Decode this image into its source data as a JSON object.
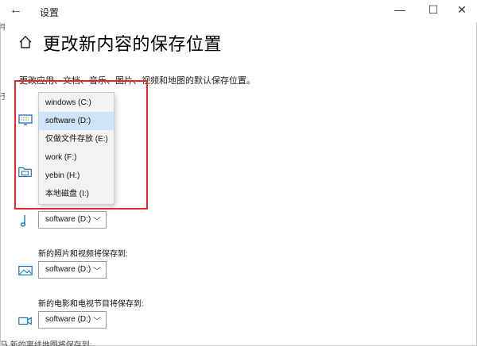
{
  "window": {
    "title": "设置",
    "back_glyph": "←",
    "minimize_glyph": "—",
    "maximize_glyph": "☐",
    "close_glyph": "✕"
  },
  "page": {
    "title": "更改新内容的保存位置",
    "description": "更改应用、文档、音乐、图片、视频和地图的默认保存位置。"
  },
  "dropdown_menu": {
    "options": [
      {
        "label": "windows (C:)",
        "selected": false
      },
      {
        "label": "software (D:)",
        "selected": true
      },
      {
        "label": "仅做文件存放 (E:)",
        "selected": false
      },
      {
        "label": "work (F:)",
        "selected": false
      },
      {
        "label": "yebin (H:)",
        "selected": false
      },
      {
        "label": "本地磁盘 (I:)",
        "selected": false
      }
    ]
  },
  "sections": {
    "music": {
      "value": "software (D:)"
    },
    "photos": {
      "label": "新的照片和视频将保存到:",
      "value": "software (D:)"
    },
    "movies": {
      "label": "新的电影和电视节目将保存到:",
      "value": "software (D:)"
    }
  },
  "icons": {
    "apps": "monitor-icon",
    "documents": "folder-icon",
    "music": "music-note-icon",
    "photos": "picture-icon",
    "movies": "video-camera-icon",
    "home": "home-icon"
  },
  "colors": {
    "accent": "#0067c0",
    "highlight_box": "#e8262d",
    "selected_item": "#cfe4f7"
  },
  "fragments": {
    "left_edge_top": "牛",
    "left_edge_mid": "于",
    "bottom_clipped": "马 新的离线地图将保存到:"
  }
}
